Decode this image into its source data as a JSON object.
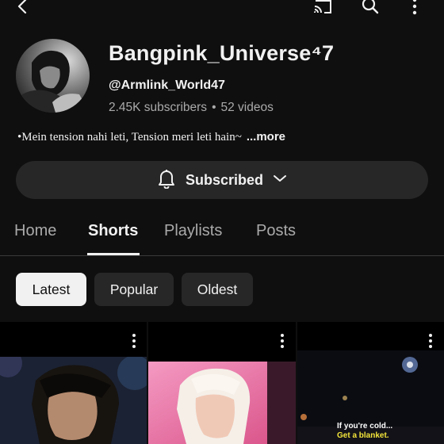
{
  "channel": {
    "name": "Bangpink_Universe⁴7",
    "handle": "@Armlink_World47",
    "subscribers": "2.45K subscribers",
    "separator": "•",
    "videos": "52 videos",
    "description": "•Mein tension nahi leti, Tension meri leti hain~",
    "more_label": "...more"
  },
  "subscribe_button": {
    "label": "Subscribed"
  },
  "tabs": [
    {
      "label": "Home",
      "active": false
    },
    {
      "label": "Shorts",
      "active": true
    },
    {
      "label": "Playlists",
      "active": false
    },
    {
      "label": "Posts",
      "active": false
    }
  ],
  "chips": [
    {
      "label": "Latest",
      "active": true
    },
    {
      "label": "Popular",
      "active": false
    },
    {
      "label": "Oldest",
      "active": false
    }
  ],
  "shorts": [
    {
      "caption_line1": "",
      "caption_line2": ""
    },
    {
      "caption_line1": "",
      "caption_line2": ""
    },
    {
      "caption_line1": "If you're cold...",
      "caption_line2": "Get a blanket."
    }
  ],
  "icons": {
    "top_bar": [
      "back-arrow-icon",
      "cast-icon",
      "search-icon",
      "more-vertical-icon"
    ],
    "subscribe": [
      "bell-icon",
      "chevron-down-icon"
    ]
  },
  "colors": {
    "background": "#0f0f0f",
    "surface": "#272727",
    "text_primary": "#f1f1f1",
    "text_secondary": "#aaaaaa",
    "caption_highlight": "#f4e53a"
  }
}
